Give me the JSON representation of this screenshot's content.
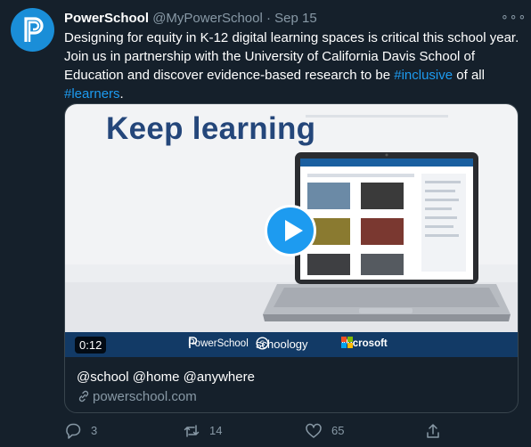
{
  "tweet": {
    "display_name": "PowerSchool",
    "handle": "@MyPowerSchool",
    "separator": "·",
    "date": "Sep 15",
    "more_label": "∘∘∘",
    "text_main": "Designing for equity in K-12 digital learning spaces is critical this school year. Join us in partnership with the University of California Davis School of Education and discover evidence-based research to be ",
    "hashtag_1": "#inclusive",
    "text_mid": " of all ",
    "hashtag_2": "#learners",
    "text_end": "."
  },
  "card": {
    "media_headline": "Keep learning",
    "duration": "0:12",
    "brands": {
      "powerschool": "PowerSchool",
      "schoology": "schoology",
      "microsoft": "Microsoft"
    },
    "title": "@school @home @anywhere",
    "domain": "powerschool.com"
  },
  "actions": {
    "reply_count": "3",
    "retweet_count": "14",
    "like_count": "65"
  },
  "colors": {
    "background": "#15202b",
    "accent": "#1d9bf0",
    "muted": "#8899a6",
    "brand_blue": "#24467a"
  },
  "icons": [
    "powerschool-logo-icon",
    "more-icon",
    "play-icon",
    "link-icon",
    "reply-icon",
    "retweet-icon",
    "like-icon",
    "share-icon"
  ]
}
